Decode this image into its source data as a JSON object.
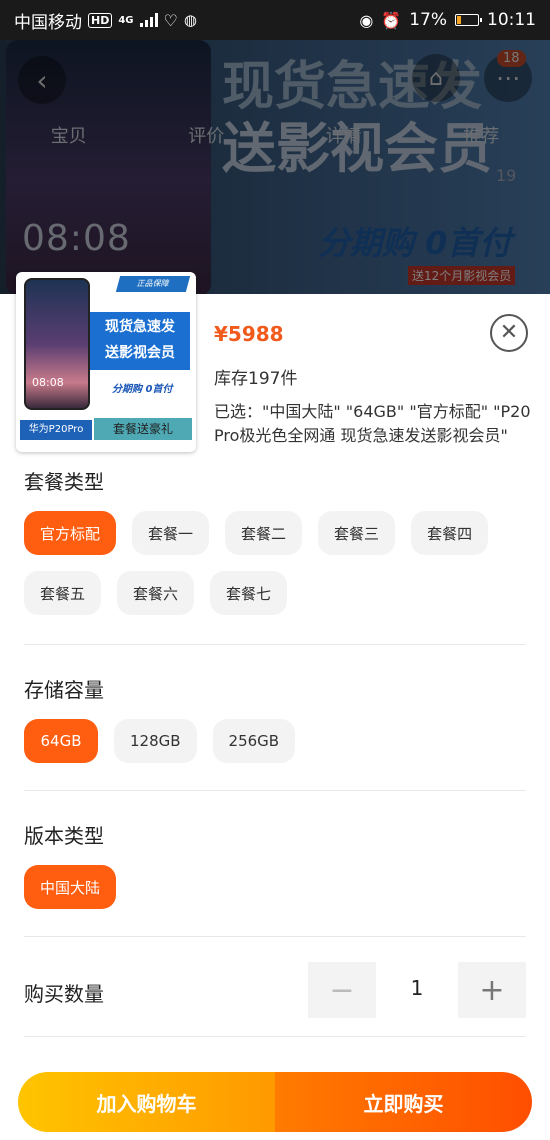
{
  "status_bar": {
    "carrier": "中国移动",
    "hd": "HD",
    "network": "4G",
    "battery": "17%",
    "time": "10:11"
  },
  "background": {
    "banner_line1": "现货急速发",
    "banner_line2": "送影视会员",
    "banner_zero": "分期购 0首付",
    "banner_promo": "送12个月影视会员",
    "screen_time": "08:08",
    "cart_badge": "18",
    "tabs": [
      "宝贝",
      "评价",
      "详情",
      "推荐"
    ],
    "page_indicator": "19"
  },
  "product": {
    "price": "¥5988",
    "stock": "库存197件",
    "selected": "已选：\"中国大陆\" \"64GB\" \"官方标配\" \"P20 Pro极光色全网通 现货急速发送影视会员\"",
    "thumb": {
      "tag": "正品保障",
      "box_line1": "现货急速发",
      "box_line2": "送影视会员",
      "zero": "分期购 0首付",
      "model": "华为P20Pro",
      "gift": "套餐送豪礼",
      "time": "08:08"
    }
  },
  "sections": {
    "package": {
      "title": "套餐类型",
      "options": [
        "官方标配",
        "套餐一",
        "套餐二",
        "套餐三",
        "套餐四",
        "套餐五",
        "套餐六",
        "套餐七"
      ],
      "selected_index": 0
    },
    "storage": {
      "title": "存储容量",
      "options": [
        "64GB",
        "128GB",
        "256GB"
      ],
      "selected_index": 0
    },
    "version": {
      "title": "版本类型",
      "options": [
        "中国大陆"
      ],
      "selected_index": 0
    }
  },
  "quantity": {
    "label": "购买数量",
    "value": "1",
    "minus": "−",
    "plus": "+"
  },
  "actions": {
    "add_to_cart": "加入购物车",
    "buy_now": "立即购买"
  },
  "colors": {
    "accent": "#ff5d0f",
    "price": "#f25a1c",
    "cart_button": "#ffb300",
    "buy_button": "#ff5a00"
  }
}
